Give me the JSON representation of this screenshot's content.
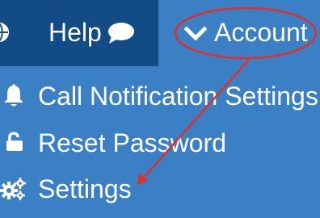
{
  "nav": {
    "help_label": "Help",
    "help_icon": "chat-bubble-icon",
    "account_label": "Account",
    "account_icon": "chevron-down-icon",
    "left_icon": "globe-icon"
  },
  "menu": {
    "items": [
      {
        "label": "Call Notification Settings",
        "icon": "bell-icon"
      },
      {
        "label": "Reset Password",
        "icon": "unlock-icon"
      },
      {
        "label": "Settings",
        "icon": "cogs-icon"
      }
    ]
  },
  "colors": {
    "bar_blue": "#3b7fc4",
    "active_tab": "#134b87",
    "text": "#ffffff",
    "annotation": "#e0302a"
  }
}
